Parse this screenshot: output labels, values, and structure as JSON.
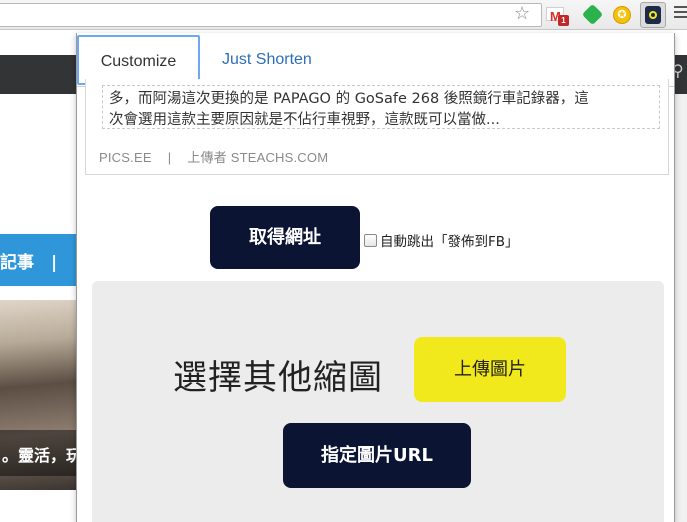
{
  "browser": {
    "extensions": [
      {
        "name": "gmail-icon",
        "badge": "1"
      },
      {
        "name": "feedly-icon"
      },
      {
        "name": "coin-icon",
        "glyph": "✪"
      },
      {
        "name": "shortener-extension-icon"
      }
    ],
    "star_glyph": "☆"
  },
  "background_page": {
    "blue_nav_text": "記事　|",
    "photo_caption": "。靈活，玩",
    "search_glyph": "⚲"
  },
  "popup": {
    "tabs": [
      {
        "label": "Customize",
        "active": true
      },
      {
        "label": "Just Shorten",
        "active": false
      }
    ],
    "preview": {
      "description_line1": "多，而阿湯這次更換的是 PAPAGO 的 GoSafe 268 後照鏡行車記錄器，這",
      "description_line2": "次會選用這款主要原因就是不佔行車視野，這款既可以當做...",
      "source_site": "PICS.EE",
      "separator": "|",
      "uploader": "上傳者 STEACHS.COM"
    },
    "get_url_button": "取得網址",
    "auto_fb_label": "自動跳出「發佈到FB」",
    "auto_fb_checked": false,
    "thumbnail": {
      "title": "選擇其他縮圖",
      "upload_button": "上傳圖片",
      "url_button": "指定圖片URL"
    }
  },
  "colors": {
    "accent_dark": "#0b1433",
    "accent_yellow": "#f2e91c",
    "tab_link": "#2f6fb7",
    "nav_blue": "#2f97d9"
  }
}
